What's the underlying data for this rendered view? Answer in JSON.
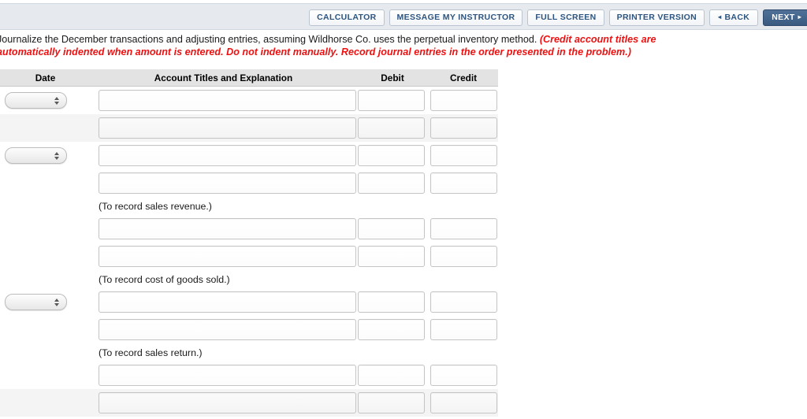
{
  "toolbar": {
    "buttons": [
      {
        "label": "CALCULATOR",
        "name": "calculator-button"
      },
      {
        "label": "MESSAGE MY INSTRUCTOR",
        "name": "message-instructor-button"
      },
      {
        "label": "FULL SCREEN",
        "name": "full-screen-button"
      },
      {
        "label": "PRINTER VERSION",
        "name": "printer-version-button"
      }
    ],
    "back_label": "BACK",
    "next_label": "NEXT",
    "back_arrow": "◂",
    "next_arrow": "▸",
    "accent_color": "#2d5580",
    "next_bg_color": "#41648c",
    "bar_color": "#e6eaef"
  },
  "instructions": {
    "line1_plain": "Journalize the December transactions and adjusting entries, assuming Wildhorse Co. uses the perpetual inventory method. ",
    "line1_hint": "(Credit account titles are",
    "line2_hint": "automatically indented when amount is entered. Do not indent manually. Record journal entries in the order presented in the problem.)",
    "hint_color": "#ee1111"
  },
  "journal": {
    "headers": {
      "date": "Date",
      "account": "Account Titles and Explanation",
      "debit": "Debit",
      "credit": "Credit"
    },
    "date_select_value": "",
    "rows": [
      {
        "kind": "entry",
        "has_date": true,
        "stripe": false
      },
      {
        "kind": "entry",
        "has_date": false,
        "stripe": true
      },
      {
        "kind": "entry",
        "has_date": true,
        "stripe": false
      },
      {
        "kind": "entry",
        "has_date": false,
        "stripe": false
      },
      {
        "kind": "note",
        "text": "(To record sales revenue.)",
        "stripe": false
      },
      {
        "kind": "entry",
        "has_date": false,
        "stripe": false
      },
      {
        "kind": "entry",
        "has_date": false,
        "stripe": false
      },
      {
        "kind": "note",
        "text": "(To record cost of goods sold.)",
        "stripe": false
      },
      {
        "kind": "entry",
        "has_date": true,
        "stripe": false
      },
      {
        "kind": "entry",
        "has_date": false,
        "stripe": false
      },
      {
        "kind": "note",
        "text": "(To record sales return.)",
        "stripe": false
      },
      {
        "kind": "entry",
        "has_date": false,
        "stripe": false
      },
      {
        "kind": "entry",
        "has_date": false,
        "stripe": true
      }
    ]
  }
}
